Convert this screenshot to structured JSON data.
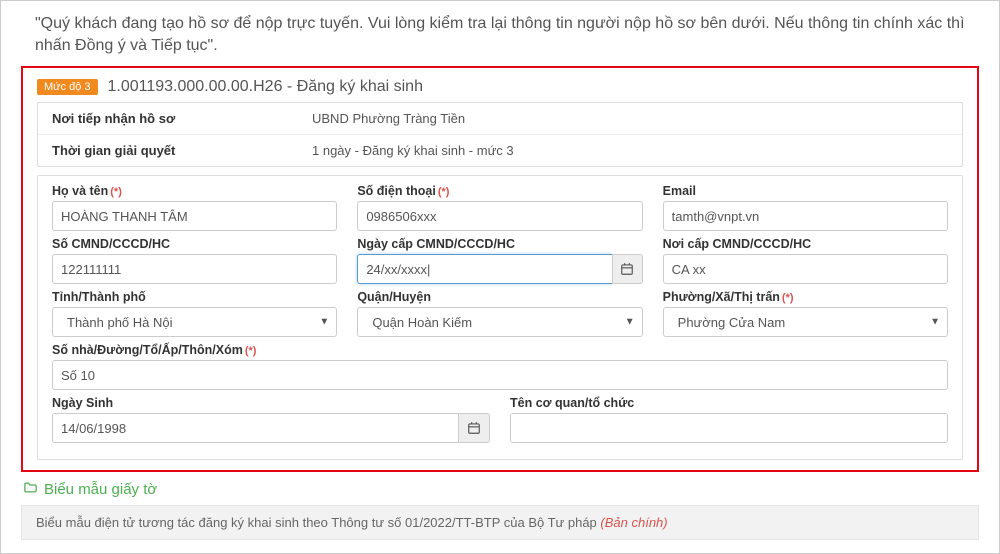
{
  "intro_text": "\"Quý khách đang tạo hồ sơ để nộp trực tuyến. Vui lòng kiểm tra lại thông tin người nộp hồ sơ bên dưới. Nếu thông tin chính xác thì nhấn Đồng ý và Tiếp tục\".",
  "procedure": {
    "level_badge": "Mức độ 3",
    "code_title": "1.001193.000.00.00.H26 - Đăng ký khai sinh"
  },
  "info": {
    "receiver_label": "Nơi tiếp nhận hồ sơ",
    "receiver_value": "UBND Phường Tràng Tiền",
    "time_label": "Thời gian giải quyết",
    "time_value": "1 ngày - Đăng ký khai sinh - mức 3"
  },
  "form": {
    "fullname_label": "Họ và tên",
    "fullname_value": "HOÀNG THANH TÂM",
    "phone_label": "Số điện thoại",
    "phone_value": "0986506xxx",
    "email_label": "Email",
    "email_value": "tamth@vnpt.vn",
    "idno_label": "Số CMND/CCCD/HC",
    "idno_value": "122111111",
    "iddate_label": "Ngày cấp CMND/CCCD/HC",
    "iddate_value": "24/xx/xxxx|",
    "idplace_label": "Nơi cấp CMND/CCCD/HC",
    "idplace_value": "CA xx",
    "province_label": "Tỉnh/Thành phố",
    "province_value": "Thành phố Hà Nội",
    "district_label": "Quận/Huyện",
    "district_value": "Quận Hoàn Kiếm",
    "ward_label": "Phường/Xã/Thị trấn",
    "ward_value": "Phường Cửa Nam",
    "address_label": "Số nhà/Đường/Tổ/Ấp/Thôn/Xóm",
    "address_value": "Số 10",
    "birth_label": "Ngày Sinh",
    "birth_value": "14/06/1998",
    "org_label": "Tên cơ quan/tổ chức",
    "org_value": ""
  },
  "section": {
    "doc_section_title": "Biểu mẫu giấy tờ",
    "doc_row_text": "Biểu mẫu điện tử tương tác đăng ký khai sinh theo Thông tư số 01/2022/TT-BTP của Bộ Tư pháp",
    "doc_row_main": "(Bản chính)"
  },
  "required_marker": "(*)"
}
